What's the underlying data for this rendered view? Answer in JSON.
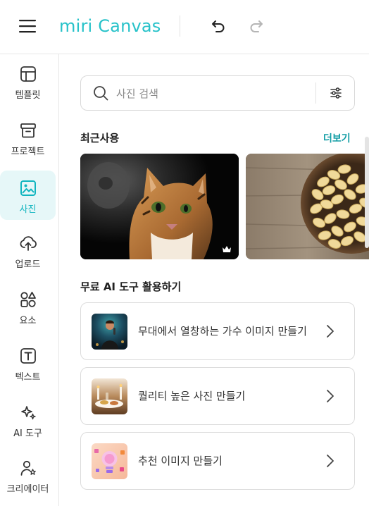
{
  "header": {
    "logo_text": "miri Canvas",
    "brand_color": "#27c2c9",
    "icons": [
      "menu-icon",
      "undo-icon",
      "redo-icon"
    ]
  },
  "sidebar": {
    "items": [
      {
        "label": "템플릿",
        "icon": "template-icon",
        "active": false
      },
      {
        "label": "프로젝트",
        "icon": "project-box-icon",
        "active": false
      },
      {
        "label": "사진",
        "icon": "photo-icon",
        "active": true
      },
      {
        "label": "업로드",
        "icon": "upload-cloud-icon",
        "active": false
      },
      {
        "label": "요소",
        "icon": "elements-shapes-icon",
        "active": false
      },
      {
        "label": "텍스트",
        "icon": "text-icon",
        "active": false
      },
      {
        "label": "AI 도구",
        "icon": "ai-sparkle-icon",
        "active": false
      },
      {
        "label": "크리에이터",
        "icon": "creator-icon",
        "active": false
      }
    ],
    "active_color": "#10b5bf",
    "active_bg": "#e6f7f8"
  },
  "search": {
    "placeholder": "사진 검색",
    "value": ""
  },
  "recent": {
    "title": "최근사용",
    "more_label": "더보기",
    "items": [
      {
        "name": "cat-photo",
        "premium": true
      },
      {
        "name": "pasta-photo",
        "premium": false
      }
    ]
  },
  "ai_tools": {
    "title": "무료 AI 도구 활용하기",
    "items": [
      {
        "label": "무대에서 열창하는 가수 이미지 만들기"
      },
      {
        "label": "퀄리티 높은 사진 만들기"
      },
      {
        "label": "추천 이미지 만들기"
      }
    ]
  }
}
